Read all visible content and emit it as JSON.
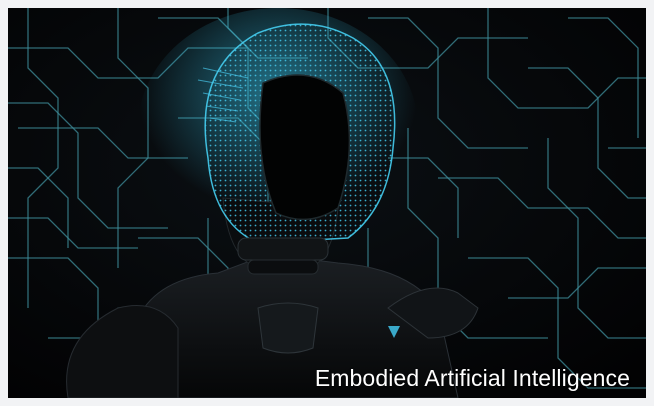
{
  "caption": {
    "text": "Embodied Artificial Intelligence"
  },
  "image": {
    "subject": "robot-head-wireframe-icon"
  },
  "colors": {
    "background": "#050608",
    "circuit": "#3f8f9c",
    "glow": "#38c4e8",
    "page": "#f2f3f5",
    "caption": "#ffffff"
  }
}
